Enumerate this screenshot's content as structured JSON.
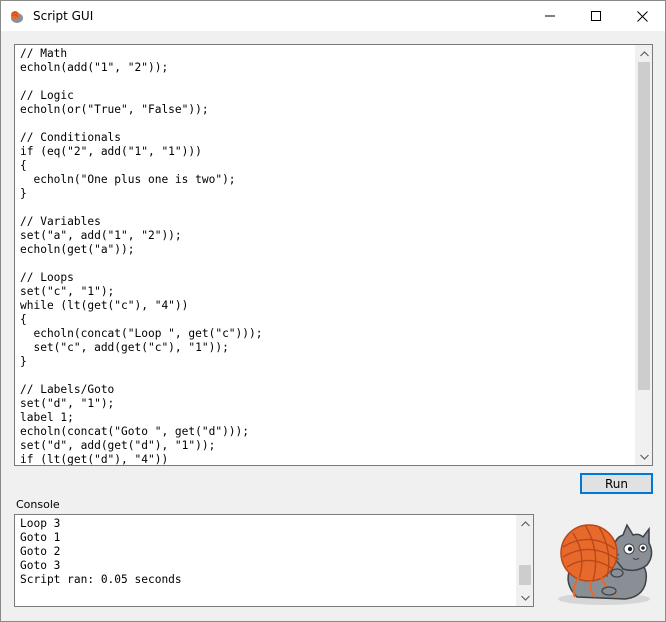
{
  "window": {
    "title": "Script GUI"
  },
  "editor": {
    "lines": [
      "// Math",
      "echoln(add(\"1\", \"2\"));",
      "",
      "// Logic",
      "echoln(or(\"True\", \"False\"));",
      "",
      "// Conditionals",
      "if (eq(\"2\", add(\"1\", \"1\")))",
      "{",
      "  echoln(\"One plus one is two\");",
      "}",
      "",
      "// Variables",
      "set(\"a\", add(\"1\", \"2\"));",
      "echoln(get(\"a\"));",
      "",
      "// Loops",
      "set(\"c\", \"1\");",
      "while (lt(get(\"c\"), \"4\"))",
      "{",
      "  echoln(concat(\"Loop \", get(\"c\")));",
      "  set(\"c\", add(get(\"c\"), \"1\"));",
      "}",
      "",
      "// Labels/Goto",
      "set(\"d\", \"1\");",
      "label 1;",
      "echoln(concat(\"Goto \", get(\"d\")));",
      "set(\"d\", add(get(\"d\"), \"1\"));",
      "if (lt(get(\"d\"), \"4\"))"
    ],
    "scroll_fraction": 0.0,
    "visible_fraction": 0.85
  },
  "toolbar": {
    "run_label": "Run"
  },
  "console": {
    "label": "Console",
    "lines": [
      "Loop 3",
      "Goto 1",
      "Goto 2",
      "Goto 3",
      "Script ran: 0.05 seconds"
    ],
    "scroll_fraction": 0.88,
    "visible_fraction": 0.35
  },
  "colors": {
    "accent": "#0078d7",
    "yarn": "#e8692c",
    "cat": "#8a8f96"
  }
}
